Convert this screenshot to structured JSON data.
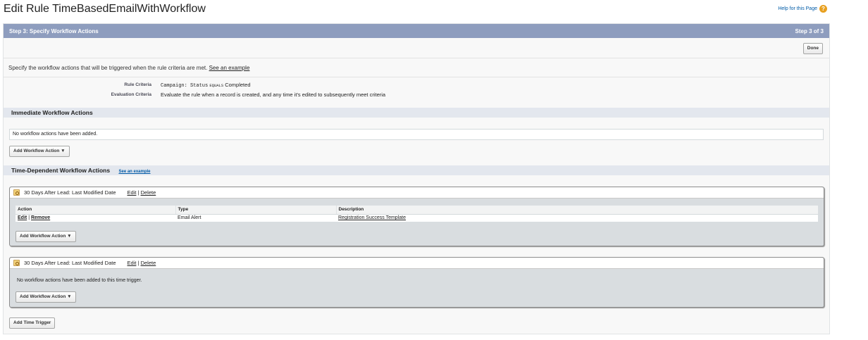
{
  "page": {
    "title": "Edit Rule TimeBasedEmailWithWorkflow",
    "help_label": "Help for this Page",
    "help_icon_glyph": "?"
  },
  "step": {
    "title": "Step 3: Specify Workflow Actions",
    "progress": "Step 3 of 3",
    "done_label": "Done"
  },
  "intro": {
    "text": "Specify the workflow actions that will be triggered when the rule criteria are met.",
    "example_link": "See an example"
  },
  "criteria": {
    "rule_label": "Rule Criteria",
    "rule_value_field": "Campaign: Status",
    "rule_value_op": "EQUALS",
    "rule_value_literal": "Completed",
    "eval_label": "Evaluation Criteria",
    "eval_value": "Evaluate the rule when a record is created, and any time it's edited to subsequently meet criteria"
  },
  "immediate": {
    "title": "Immediate Workflow Actions",
    "empty_message": "No workflow actions have been added.",
    "add_button": "Add Workflow Action  ▼"
  },
  "time_dependent": {
    "title": "Time-Dependent Workflow Actions",
    "example_link": "See an example",
    "triggers": [
      {
        "label": "30 Days After Lead: Last Modified Date",
        "edit": "Edit",
        "sep": "|",
        "delete": "Delete",
        "columns": [
          "Action",
          "Type",
          "Description"
        ],
        "rows": [
          {
            "edit": "Edit",
            "sep": "|",
            "remove": "Remove",
            "type": "Email Alert",
            "description": "Registration Success Template"
          }
        ],
        "add_button": "Add Workflow Action  ▼"
      },
      {
        "label": "30 Days After Lead: Last Modified Date",
        "edit": "Edit",
        "sep": "|",
        "delete": "Delete",
        "empty_message": "No workflow actions have been added to this time trigger.",
        "add_button": "Add Workflow Action  ▼"
      }
    ],
    "add_time_trigger": "Add Time Trigger"
  },
  "colors": {
    "step_header_bg": "#8e9dbe",
    "section_bar_bg": "#e3e7ee",
    "help_icon": "#e8a020",
    "link": "#015ba7"
  },
  "icons": {
    "help": "help-icon",
    "trigger": "clock-icon"
  }
}
